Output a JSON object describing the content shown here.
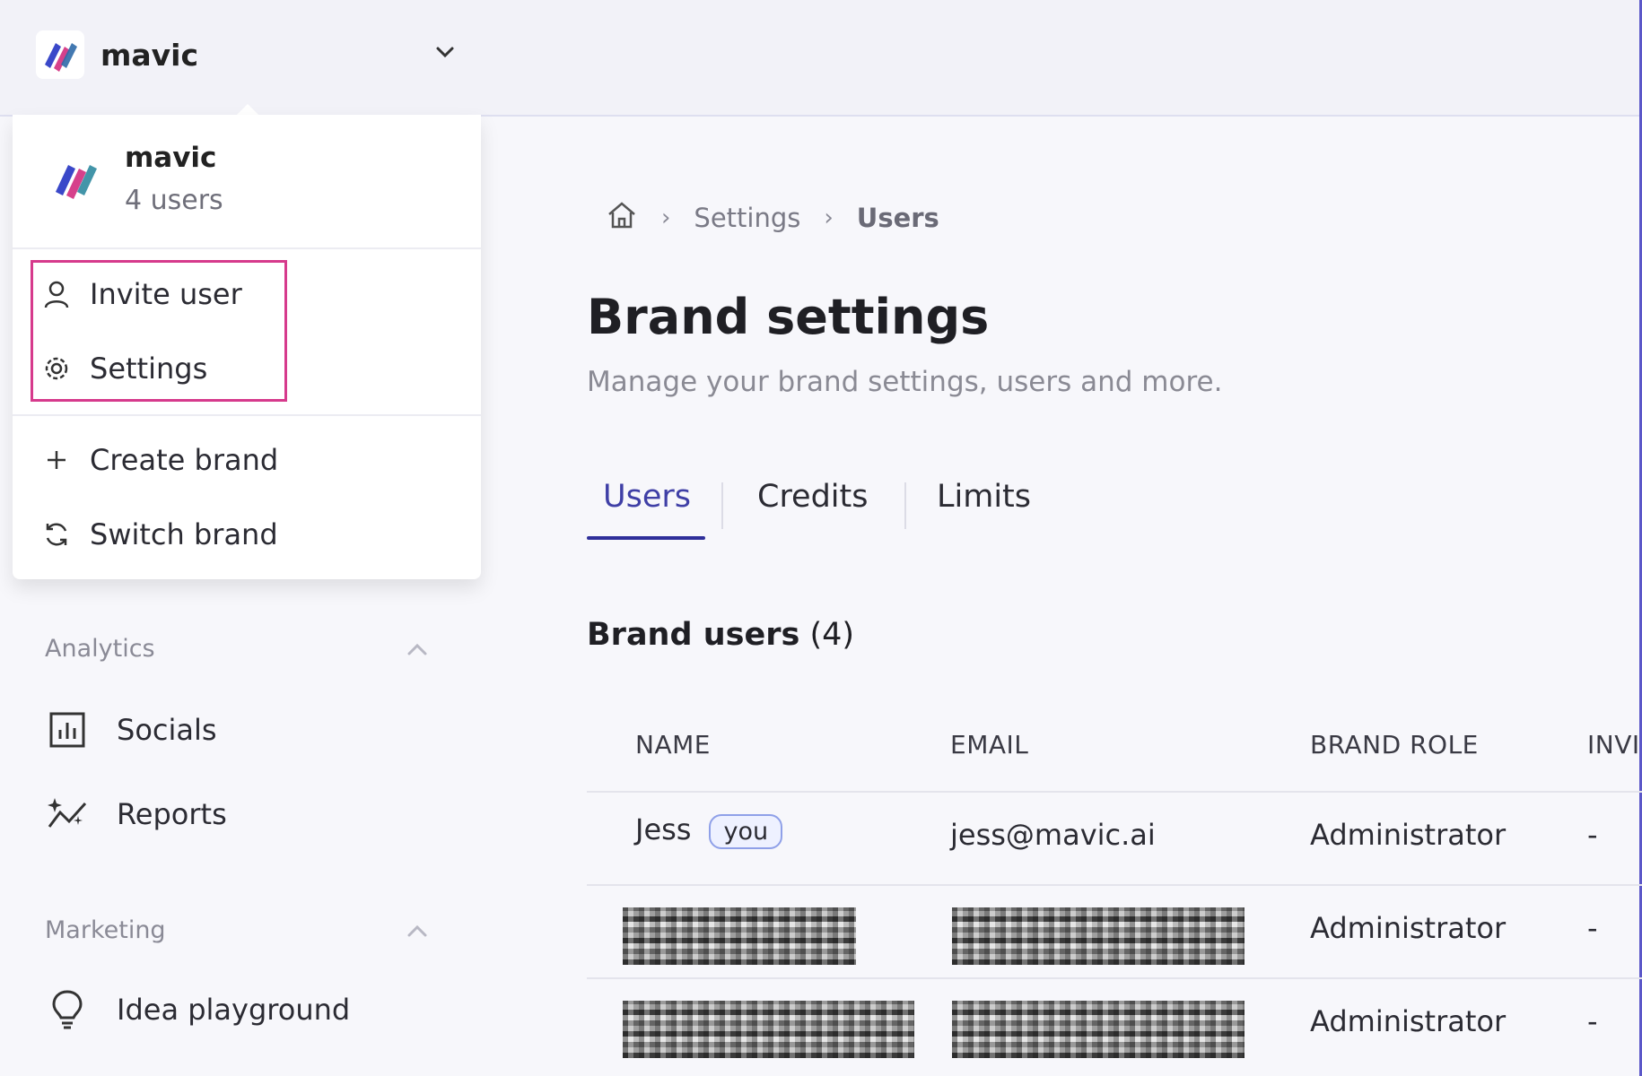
{
  "brand": {
    "name": "mavic",
    "users_count": "4 users"
  },
  "menu": {
    "items": [
      {
        "label": "Invite user",
        "icon": "user-icon"
      },
      {
        "label": "Settings",
        "icon": "gear-icon"
      },
      {
        "label": "Create brand",
        "icon": "plus-icon"
      },
      {
        "label": "Switch brand",
        "icon": "refresh-icon"
      }
    ]
  },
  "sidebar": {
    "sections": [
      {
        "title": "Analytics",
        "items": [
          {
            "label": "Socials",
            "icon": "bar-chart-icon"
          },
          {
            "label": "Reports",
            "icon": "sparkle-chart-icon"
          }
        ]
      },
      {
        "title": "Marketing",
        "items": [
          {
            "label": "Idea playground",
            "icon": "lightbulb-icon"
          }
        ]
      }
    ]
  },
  "breadcrumb": {
    "items": [
      "Settings",
      "Users"
    ],
    "separator": "›"
  },
  "page": {
    "title": "Brand settings",
    "subtitle": "Manage your brand settings, users and more."
  },
  "tabs": [
    {
      "label": "Users",
      "active": true
    },
    {
      "label": "Credits"
    },
    {
      "label": "Limits"
    }
  ],
  "section": {
    "title": "Brand users",
    "count": "(4)"
  },
  "table": {
    "headers": [
      "NAME",
      "EMAIL",
      "BRAND ROLE",
      "INVI"
    ],
    "rows": [
      {
        "name": "Jess",
        "badge": "you",
        "email": "jess@mavic.ai",
        "role": "Administrator",
        "invited": "-"
      },
      {
        "role": "Administrator",
        "invited": "-"
      },
      {
        "role": "Administrator",
        "invited": "-"
      }
    ]
  },
  "colors": {
    "accent": "#3f3fa6",
    "highlight": "#d63a8c"
  }
}
